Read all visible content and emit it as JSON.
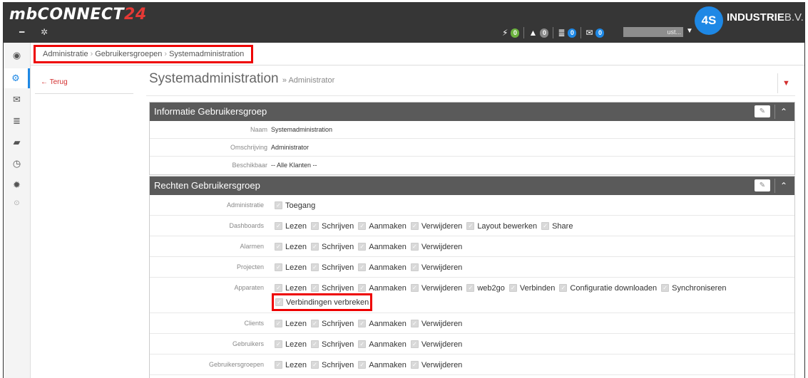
{
  "app": {
    "logo_main": "mbCONNECT",
    "logo_accent": "24"
  },
  "topbar": {
    "alerts": [
      {
        "icon": "bolt-icon",
        "glyph": "⚡",
        "count": "0",
        "color": "#6cb33f"
      },
      {
        "icon": "warning-icon",
        "glyph": "▲",
        "count": "0",
        "color": "#888888"
      },
      {
        "icon": "server-icon",
        "glyph": "≣",
        "count": "0",
        "color": "#1e88e5"
      },
      {
        "icon": "envelope-icon",
        "glyph": "✉",
        "count": "0",
        "color": "#1e88e5"
      }
    ],
    "user_name": "ust...",
    "brand_logo": "4S",
    "brand_name": "INDUSTRIE",
    "brand_suffix": "B.V."
  },
  "breadcrumb": [
    "Administratie",
    "Gebruikersgroepen",
    "Systemadministration"
  ],
  "subnav": {
    "back": "Terug"
  },
  "page": {
    "title": "Systemadministration",
    "subtitle": "» Administrator"
  },
  "info_panel": {
    "title": "Informatie Gebruikersgroep",
    "rows": [
      {
        "label": "Naam",
        "value": "Systemadministration"
      },
      {
        "label": "Omschrijving",
        "value": "Administrator"
      },
      {
        "label": "Beschikbaar",
        "value": "-- Alle Klanten --"
      }
    ]
  },
  "rights_panel": {
    "title": "Rechten Gebruikersgroep",
    "rows": [
      {
        "label": "Administratie",
        "perms": [
          "Toegang"
        ]
      },
      {
        "label": "Dashboards",
        "perms": [
          "Lezen",
          "Schrijven",
          "Aanmaken",
          "Verwijderen",
          "Layout bewerken",
          "Share"
        ]
      },
      {
        "label": "Alarmen",
        "perms": [
          "Lezen",
          "Schrijven",
          "Aanmaken",
          "Verwijderen"
        ]
      },
      {
        "label": "Projecten",
        "perms": [
          "Lezen",
          "Schrijven",
          "Aanmaken",
          "Verwijderen"
        ]
      },
      {
        "label": "Apparaten",
        "perms": [
          "Lezen",
          "Schrijven",
          "Aanmaken",
          "Verwijderen",
          "web2go",
          "Verbinden",
          "Configuratie downloaden",
          "Synchroniseren",
          "Verbindingen verbreken"
        ]
      },
      {
        "label": "Clients",
        "perms": [
          "Lezen",
          "Schrijven",
          "Aanmaken",
          "Verwijderen"
        ]
      },
      {
        "label": "Gebruikers",
        "perms": [
          "Lezen",
          "Schrijven",
          "Aanmaken",
          "Verwijderen"
        ]
      },
      {
        "label": "Gebruikersgroepen",
        "perms": [
          "Lezen",
          "Schrijven",
          "Aanmaken",
          "Verwijderen"
        ]
      }
    ]
  },
  "colors": {
    "accent": "#1e88e5",
    "highlight": "#ee0000",
    "panel_header": "#5a5a5a"
  }
}
